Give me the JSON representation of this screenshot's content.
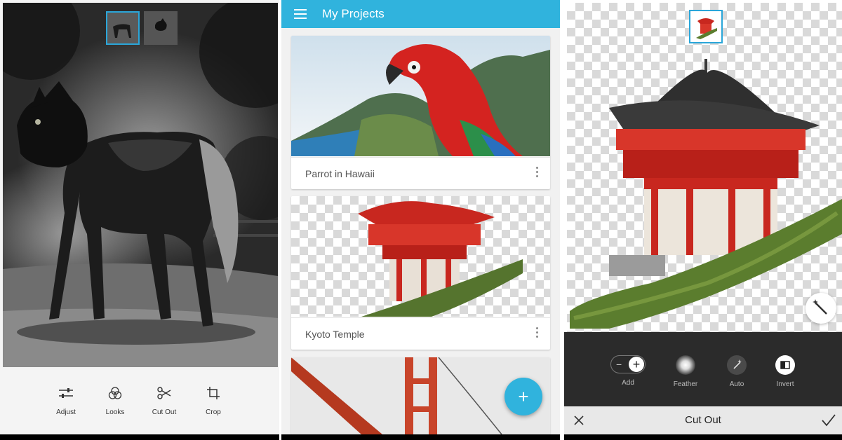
{
  "left": {
    "tools": [
      {
        "label": "Adjust",
        "icon": "sliders-icon"
      },
      {
        "label": "Looks",
        "icon": "looks-circles-icon"
      },
      {
        "label": "Cut Out",
        "icon": "scissors-icon"
      },
      {
        "label": "Crop",
        "icon": "crop-icon"
      }
    ]
  },
  "middle": {
    "app_title": "My Projects",
    "projects": [
      {
        "name": "Parrot in Hawaii"
      },
      {
        "name": "Kyoto Temple"
      }
    ],
    "fab_label": "+"
  },
  "right": {
    "tools": [
      {
        "label": "Add",
        "icon": "add-subtract-icon"
      },
      {
        "label": "Feather",
        "icon": "feather-icon"
      },
      {
        "label": "Auto",
        "icon": "magic-wand-icon"
      },
      {
        "label": "Invert",
        "icon": "invert-icon"
      }
    ],
    "bar_title": "Cut Out"
  },
  "colors": {
    "accent": "#30b3dd",
    "selection_border": "#2aa6d9",
    "temple_red": "#c8271f",
    "dark_toolbar": "#2b2b2b"
  }
}
